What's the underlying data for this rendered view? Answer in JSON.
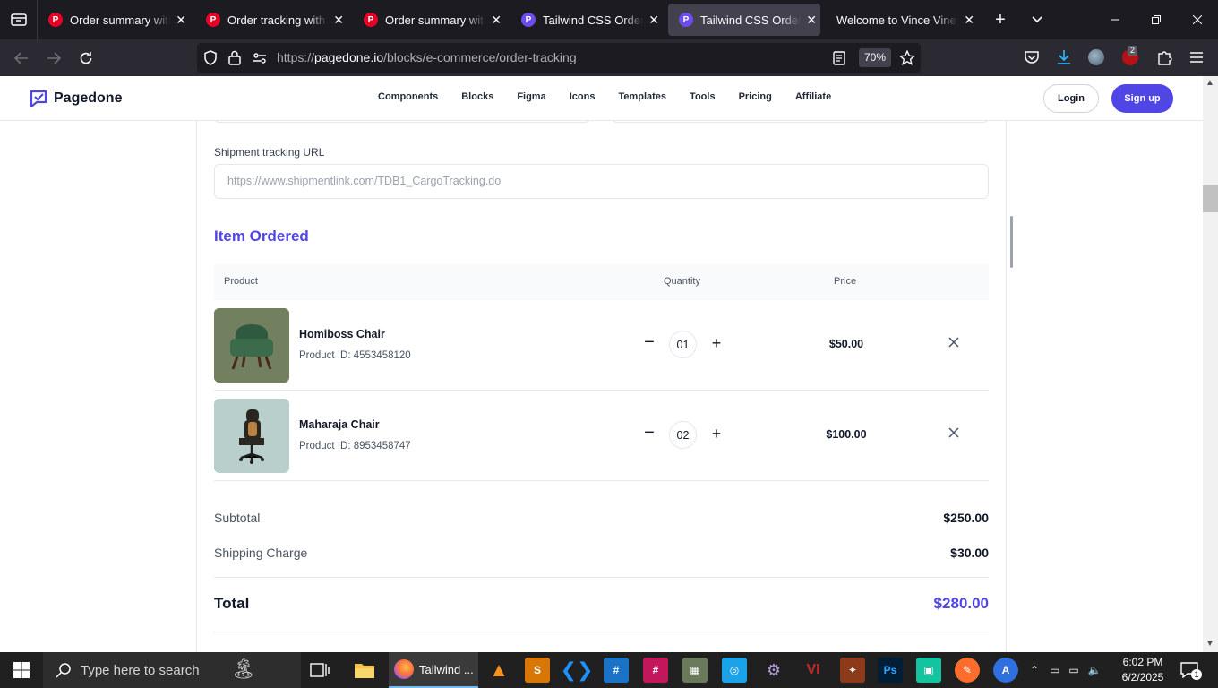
{
  "browser": {
    "tabs": [
      {
        "title": "Order summary with di",
        "favicon": "pinterest",
        "active": false
      },
      {
        "title": "Order tracking with ma",
        "favicon": "pinterest",
        "active": false
      },
      {
        "title": "Order summary with cl",
        "favicon": "pinterest",
        "active": false
      },
      {
        "title": "Tailwind CSS Order Sur",
        "favicon": "pagedone",
        "active": false
      },
      {
        "title": "Tailwind CSS Order Tra",
        "favicon": "pagedone",
        "active": true
      },
      {
        "title": "Welcome to Vince Vineyar",
        "favicon": "none",
        "active": false
      }
    ],
    "url_prefix": "https://",
    "url_domain": "pagedone.io",
    "url_path": "/blocks/e-commerce/order-tracking",
    "zoom": "70%",
    "extension_badge": "2"
  },
  "site": {
    "brand": "Pagedone",
    "menu": [
      "Components",
      "Blocks",
      "Figma",
      "Icons",
      "Templates",
      "Tools",
      "Pricing",
      "Affiliate"
    ],
    "login": "Login",
    "signup": "Sign up",
    "accent": "#4f46e5"
  },
  "tracking": {
    "label": "Shipment tracking URL",
    "placeholder": "https://www.shipmentlink.com/TDB1_CargoTracking.do"
  },
  "items": {
    "title": "Item Ordered",
    "headers": {
      "product": "Product",
      "quantity": "Quantity",
      "price": "Price"
    },
    "rows": [
      {
        "name": "Homiboss Chair",
        "product_id": "Product ID: 4553458120",
        "qty": "01",
        "price": "$50.00"
      },
      {
        "name": "Maharaja Chair",
        "product_id": "Product ID: 8953458747",
        "qty": "02",
        "price": "$100.00"
      }
    ]
  },
  "summary": {
    "subtotal_label": "Subtotal",
    "subtotal_value": "$250.00",
    "shipping_label": "Shipping Charge",
    "shipping_value": "$30.00",
    "total_label": "Total",
    "total_value": "$280.00"
  },
  "taskbar": {
    "search_placeholder": "Type here to search",
    "active_app_label": "Tailwind ...",
    "time": "6:02 PM",
    "date": "6/2/2025",
    "notification_count": "1"
  }
}
